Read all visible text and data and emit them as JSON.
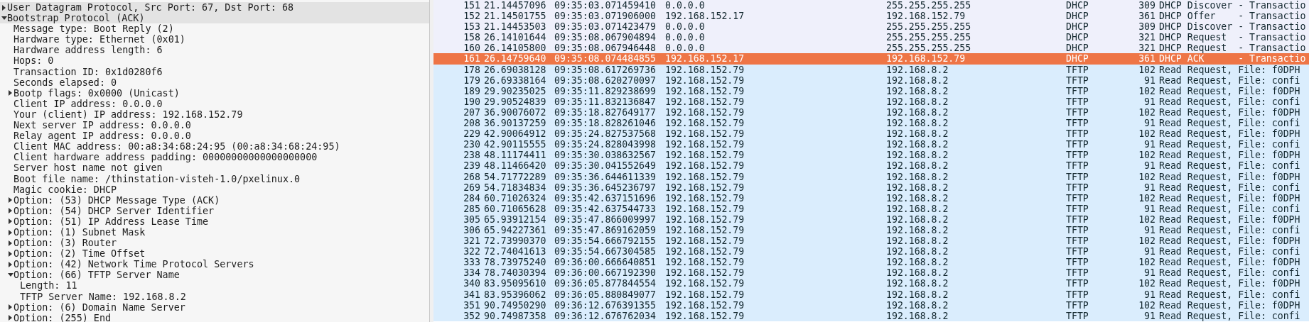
{
  "details": [
    {
      "label": "User Datagram Protocol, Src Port: 67, Dst Port: 68",
      "expanded": false
    },
    {
      "label": "Bootstrap Protocol (ACK)",
      "expanded": true,
      "children": [
        {
          "label": "Message type: Boot Reply (2)"
        },
        {
          "label": "Hardware type: Ethernet (0x01)"
        },
        {
          "label": "Hardware address length: 6"
        },
        {
          "label": "Hops: 0"
        },
        {
          "label": "Transaction ID: 0x1d0280f6"
        },
        {
          "label": "Seconds elapsed: 0"
        },
        {
          "label": "Bootp flags: 0x0000 (Unicast)",
          "expanded": false
        },
        {
          "label": "Client IP address: 0.0.0.0"
        },
        {
          "label": "Your (client) IP address: 192.168.152.79"
        },
        {
          "label": "Next server IP address: 0.0.0.0"
        },
        {
          "label": "Relay agent IP address: 0.0.0.0"
        },
        {
          "label": "Client MAC address: 00:a8:34:68:24:95 (00:a8:34:68:24:95)"
        },
        {
          "label": "Client hardware address padding: 00000000000000000000"
        },
        {
          "label": "Server host name not given"
        },
        {
          "label": "Boot file name: /thinstation-visteh-1.0/pxelinux.0"
        },
        {
          "label": "Magic cookie: DHCP"
        },
        {
          "label": "Option: (53) DHCP Message Type (ACK)",
          "expanded": false
        },
        {
          "label": "Option: (54) DHCP Server Identifier",
          "expanded": false
        },
        {
          "label": "Option: (51) IP Address Lease Time",
          "expanded": false
        },
        {
          "label": "Option: (1) Subnet Mask",
          "expanded": false
        },
        {
          "label": "Option: (3) Router",
          "expanded": false
        },
        {
          "label": "Option: (2) Time Offset",
          "expanded": false
        },
        {
          "label": "Option: (42) Network Time Protocol Servers",
          "expanded": false
        },
        {
          "label": "Option: (66) TFTP Server Name",
          "expanded": true,
          "children": [
            {
              "label": "Length: 11"
            },
            {
              "label": "TFTP Server Name: 192.168.8.2"
            }
          ]
        },
        {
          "label": "Option: (6) Domain Name Server",
          "expanded": false
        },
        {
          "label": "Option: (255) End",
          "expanded": false
        }
      ]
    }
  ],
  "packets": [
    {
      "no": "151",
      "time": "21.14457096",
      "abs_time": "09:35:03.071459410",
      "source": "0.0.0.0",
      "destination": "255.255.255.255",
      "protocol": "DHCP",
      "length": "309",
      "info": "DHCP Discover - Transactio",
      "selected": false,
      "color": "#eff0fb"
    },
    {
      "no": "152",
      "time": "21.14501755",
      "abs_time": "09:35:03.071906000",
      "source": "192.168.152.17",
      "destination": "192.168.152.79",
      "protocol": "DHCP",
      "length": "361",
      "info": "DHCP Offer    - Transactio",
      "selected": false,
      "color": "#eff0fb"
    },
    {
      "no": "153",
      "time": "21.14453503",
      "abs_time": "09:35:03.071423479",
      "source": "0.0.0.0",
      "destination": "255.255.255.255",
      "protocol": "DHCP",
      "length": "309",
      "info": "DHCP Discover - Transactio",
      "selected": false,
      "color": "#eff0fb"
    },
    {
      "no": "158",
      "time": "26.14101644",
      "abs_time": "09:35:08.067904894",
      "source": "0.0.0.0",
      "destination": "255.255.255.255",
      "protocol": "DHCP",
      "length": "321",
      "info": "DHCP Request  - Transactio",
      "selected": false,
      "color": "#eff0fb"
    },
    {
      "no": "160",
      "time": "26.14105800",
      "abs_time": "09:35:08.067946448",
      "source": "0.0.0.0",
      "destination": "255.255.255.255",
      "protocol": "DHCP",
      "length": "321",
      "info": "DHCP Request  - Transactio",
      "selected": false,
      "color": "#eff0fb"
    },
    {
      "no": "161",
      "time": "26.14759640",
      "abs_time": "09:35:08.074484855",
      "source": "192.168.152.17",
      "destination": "192.168.152.79",
      "protocol": "DHCP",
      "length": "361",
      "info": "DHCP ACK      - Transactio",
      "selected": true
    },
    {
      "no": "178",
      "time": "26.69038128",
      "abs_time": "09:35:08.617269736",
      "source": "192.168.152.79",
      "destination": "192.168.8.2",
      "protocol": "TFTP",
      "length": "102",
      "info": "Read Request, File: f0DPH",
      "selected": false,
      "color": "#daedfd"
    },
    {
      "no": "179",
      "time": "26.69338164",
      "abs_time": "09:35:08.620270097",
      "source": "192.168.152.79",
      "destination": "192.168.8.2",
      "protocol": "TFTP",
      "length": "91",
      "info": "Read Request, File: confi",
      "selected": false,
      "color": "#daedfd"
    },
    {
      "no": "189",
      "time": "29.90235025",
      "abs_time": "09:35:11.829238699",
      "source": "192.168.152.79",
      "destination": "192.168.8.2",
      "protocol": "TFTP",
      "length": "102",
      "info": "Read Request, File: f0DPH",
      "selected": false,
      "color": "#daedfd"
    },
    {
      "no": "190",
      "time": "29.90524839",
      "abs_time": "09:35:11.832136847",
      "source": "192.168.152.79",
      "destination": "192.168.8.2",
      "protocol": "TFTP",
      "length": "91",
      "info": "Read Request, File: confi",
      "selected": false,
      "color": "#daedfd"
    },
    {
      "no": "207",
      "time": "36.90076072",
      "abs_time": "09:35:18.827649177",
      "source": "192.168.152.79",
      "destination": "192.168.8.2",
      "protocol": "TFTP",
      "length": "102",
      "info": "Read Request, File: f0DPH",
      "selected": false,
      "color": "#daedfd"
    },
    {
      "no": "208",
      "time": "36.90137259",
      "abs_time": "09:35:18.828261046",
      "source": "192.168.152.79",
      "destination": "192.168.8.2",
      "protocol": "TFTP",
      "length": "91",
      "info": "Read Request, File: confi",
      "selected": false,
      "color": "#daedfd"
    },
    {
      "no": "229",
      "time": "42.90064912",
      "abs_time": "09:35:24.827537568",
      "source": "192.168.152.79",
      "destination": "192.168.8.2",
      "protocol": "TFTP",
      "length": "102",
      "info": "Read Request, File: f0DPH",
      "selected": false,
      "color": "#daedfd"
    },
    {
      "no": "230",
      "time": "42.90115555",
      "abs_time": "09:35:24.828043998",
      "source": "192.168.152.79",
      "destination": "192.168.8.2",
      "protocol": "TFTP",
      "length": "91",
      "info": "Read Request, File: confi",
      "selected": false,
      "color": "#daedfd"
    },
    {
      "no": "238",
      "time": "48.11174411",
      "abs_time": "09:35:30.038632567",
      "source": "192.168.152.79",
      "destination": "192.168.8.2",
      "protocol": "TFTP",
      "length": "102",
      "info": "Read Request, File: f0DPH",
      "selected": false,
      "color": "#daedfd"
    },
    {
      "no": "239",
      "time": "48.11466420",
      "abs_time": "09:35:30.041552649",
      "source": "192.168.152.79",
      "destination": "192.168.8.2",
      "protocol": "TFTP",
      "length": "91",
      "info": "Read Request, File: confi",
      "selected": false,
      "color": "#daedfd"
    },
    {
      "no": "268",
      "time": "54.71772289",
      "abs_time": "09:35:36.644611339",
      "source": "192.168.152.79",
      "destination": "192.168.8.2",
      "protocol": "TFTP",
      "length": "102",
      "info": "Read Request, File: f0DPH",
      "selected": false,
      "color": "#daedfd"
    },
    {
      "no": "269",
      "time": "54.71834834",
      "abs_time": "09:35:36.645236797",
      "source": "192.168.152.79",
      "destination": "192.168.8.2",
      "protocol": "TFTP",
      "length": "91",
      "info": "Read Request, File: confi",
      "selected": false,
      "color": "#daedfd"
    },
    {
      "no": "284",
      "time": "60.71026324",
      "abs_time": "09:35:42.637151696",
      "source": "192.168.152.79",
      "destination": "192.168.8.2",
      "protocol": "TFTP",
      "length": "102",
      "info": "Read Request, File: f0DPH",
      "selected": false,
      "color": "#daedfd"
    },
    {
      "no": "285",
      "time": "60.71065628",
      "abs_time": "09:35:42.637544733",
      "source": "192.168.152.79",
      "destination": "192.168.8.2",
      "protocol": "TFTP",
      "length": "91",
      "info": "Read Request, File: confi",
      "selected": false,
      "color": "#daedfd"
    },
    {
      "no": "305",
      "time": "65.93912154",
      "abs_time": "09:35:47.866009997",
      "source": "192.168.152.79",
      "destination": "192.168.8.2",
      "protocol": "TFTP",
      "length": "102",
      "info": "Read Request, File: f0DPH",
      "selected": false,
      "color": "#daedfd"
    },
    {
      "no": "306",
      "time": "65.94227361",
      "abs_time": "09:35:47.869162059",
      "source": "192.168.152.79",
      "destination": "192.168.8.2",
      "protocol": "TFTP",
      "length": "91",
      "info": "Read Request, File: confi",
      "selected": false,
      "color": "#daedfd"
    },
    {
      "no": "321",
      "time": "72.73990370",
      "abs_time": "09:35:54.666792155",
      "source": "192.168.152.79",
      "destination": "192.168.8.2",
      "protocol": "TFTP",
      "length": "102",
      "info": "Read Request, File: f0DPH",
      "selected": false,
      "color": "#daedfd"
    },
    {
      "no": "322",
      "time": "72.74041613",
      "abs_time": "09:35:54.667304585",
      "source": "192.168.152.79",
      "destination": "192.168.8.2",
      "protocol": "TFTP",
      "length": "91",
      "info": "Read Request, File: confi",
      "selected": false,
      "color": "#daedfd"
    },
    {
      "no": "333",
      "time": "78.73975240",
      "abs_time": "09:36:00.666640851",
      "source": "192.168.152.79",
      "destination": "192.168.8.2",
      "protocol": "TFTP",
      "length": "102",
      "info": "Read Request, File: f0DPH",
      "selected": false,
      "color": "#daedfd"
    },
    {
      "no": "334",
      "time": "78.74030394",
      "abs_time": "09:36:00.667192390",
      "source": "192.168.152.79",
      "destination": "192.168.8.2",
      "protocol": "TFTP",
      "length": "91",
      "info": "Read Request, File: confi",
      "selected": false,
      "color": "#daedfd"
    },
    {
      "no": "340",
      "time": "83.95095610",
      "abs_time": "09:36:05.877844554",
      "source": "192.168.152.79",
      "destination": "192.168.8.2",
      "protocol": "TFTP",
      "length": "102",
      "info": "Read Request, File: f0DPH",
      "selected": false,
      "color": "#daedfd"
    },
    {
      "no": "341",
      "time": "83.95396062",
      "abs_time": "09:36:05.880849077",
      "source": "192.168.152.79",
      "destination": "192.168.8.2",
      "protocol": "TFTP",
      "length": "91",
      "info": "Read Request, File: confi",
      "selected": false,
      "color": "#daedfd"
    },
    {
      "no": "351",
      "time": "90.74950290",
      "abs_time": "09:36:12.676391355",
      "source": "192.168.152.79",
      "destination": "192.168.8.2",
      "protocol": "TFTP",
      "length": "102",
      "info": "Read Request, File: f0DPH",
      "selected": false,
      "color": "#daedfd"
    },
    {
      "no": "352",
      "time": "90.74987358",
      "abs_time": "09:36:12.676762034",
      "source": "192.168.152.79",
      "destination": "192.168.8.2",
      "protocol": "TFTP",
      "length": "91",
      "info": "Read Request, File: confi",
      "selected": false,
      "color": "#daedfd"
    }
  ]
}
